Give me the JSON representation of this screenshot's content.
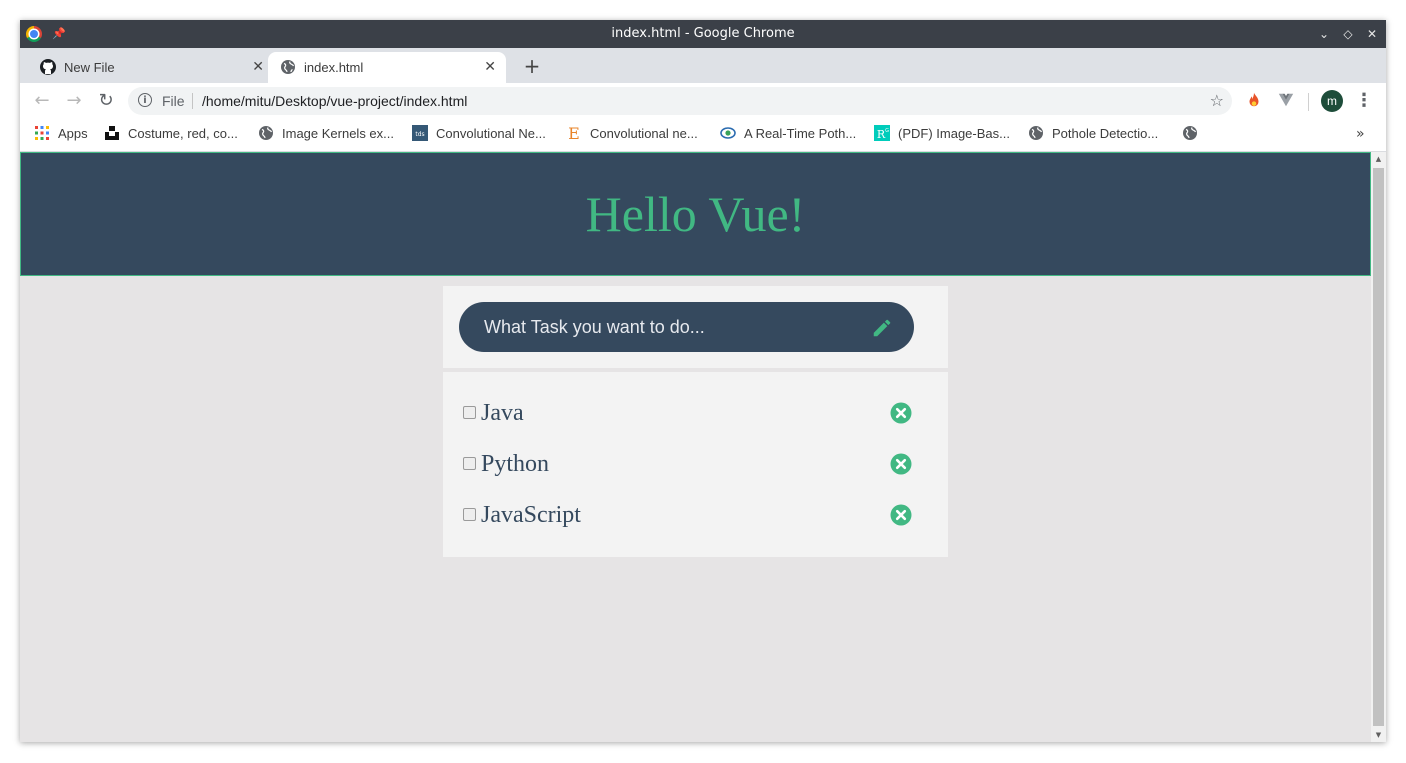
{
  "window": {
    "title": "index.html - Google Chrome",
    "controls": {
      "minimize": "⌄",
      "restore": "◇",
      "close": "✕"
    }
  },
  "tabs": [
    {
      "label": "New File",
      "icon": "github-icon",
      "active": false
    },
    {
      "label": "index.html",
      "icon": "globe-icon",
      "active": true
    }
  ],
  "toolbar": {
    "scheme_label": "File",
    "url": "/home/mitu/Desktop/vue-project/index.html",
    "profile_initial": "m"
  },
  "bookmarks": [
    {
      "label": "Apps",
      "icon": "apps-grid-icon"
    },
    {
      "label": "Costume, red, co...",
      "icon": "unsplash-icon"
    },
    {
      "label": "Image Kernels ex...",
      "icon": "globe-icon"
    },
    {
      "label": "Convolutional Ne...",
      "icon": "tds-icon"
    },
    {
      "label": "Convolutional ne...",
      "icon": "e-letter-icon"
    },
    {
      "label": "A Real-Time Poth...",
      "icon": "eye-icon"
    },
    {
      "label": "(PDF) Image-Bas...",
      "icon": "researchgate-icon"
    },
    {
      "label": "Pothole Detectio...",
      "icon": "globe-icon"
    },
    {
      "label": "",
      "icon": "globe-icon"
    }
  ],
  "page": {
    "heading": "Hello Vue!",
    "input_placeholder": "What Task you want to do...",
    "tasks": [
      {
        "name": "Java",
        "done": false
      },
      {
        "name": "Python",
        "done": false
      },
      {
        "name": "JavaScript",
        "done": false
      }
    ]
  },
  "colors": {
    "vue_green": "#41b883",
    "vue_navy": "#35495e",
    "page_bg": "#e6e4e5",
    "card_bg": "#f3f3f3"
  }
}
